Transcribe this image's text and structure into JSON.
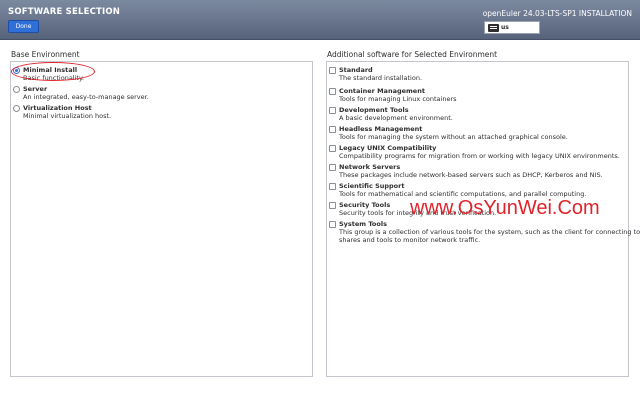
{
  "header": {
    "screen_title": "SOFTWARE SELECTION",
    "done_label": "Done",
    "product_title": "openEuler 24.03-LTS-SP1 INSTALLATION",
    "keyboard_layout": "us",
    "keyboard_icon": "keyboard-icon",
    "colors": {
      "header_bg": "#6b7890",
      "done_button": "#2f6fd7"
    }
  },
  "base_environment": {
    "title": "Base Environment",
    "options": [
      {
        "name": "Minimal Install",
        "description": "Basic functionality.",
        "selected": true
      },
      {
        "name": "Server",
        "description": "An integrated, easy-to-manage server.",
        "selected": false
      },
      {
        "name": "Virtualization Host",
        "description": "Minimal virtualization host.",
        "selected": false
      }
    ]
  },
  "additional_software": {
    "title": "Additional software for Selected Environment",
    "items": [
      {
        "name": "Standard",
        "description": "The standard installation.",
        "checked": false
      },
      {
        "name": "Container Management",
        "description": "Tools for managing Linux containers",
        "checked": false
      },
      {
        "name": "Development Tools",
        "description": "A basic development environment.",
        "checked": false
      },
      {
        "name": "Headless Management",
        "description": "Tools for managing the system without an attached graphical console.",
        "checked": false
      },
      {
        "name": "Legacy UNIX Compatibility",
        "description": "Compatibility programs for migration from or working with legacy UNIX environments.",
        "checked": false
      },
      {
        "name": "Network Servers",
        "description": "These packages include network-based servers such as DHCP, Kerberos and NIS.",
        "checked": false
      },
      {
        "name": "Scientific Support",
        "description": "Tools for mathematical and scientific computations, and parallel computing.",
        "checked": false
      },
      {
        "name": "Security Tools",
        "description": "Security tools for integrity and trust verification.",
        "checked": false
      },
      {
        "name": "System Tools",
        "description": "This group is a collection of various tools for the system, such as the client for connecting to SMB",
        "description_line2": "shares and tools to monitor network traffic.",
        "checked": false
      }
    ]
  },
  "watermark": {
    "text": "www.OsYunWei.Com",
    "color": "#e0242b"
  },
  "annotation": {
    "color": "#e0242b"
  }
}
